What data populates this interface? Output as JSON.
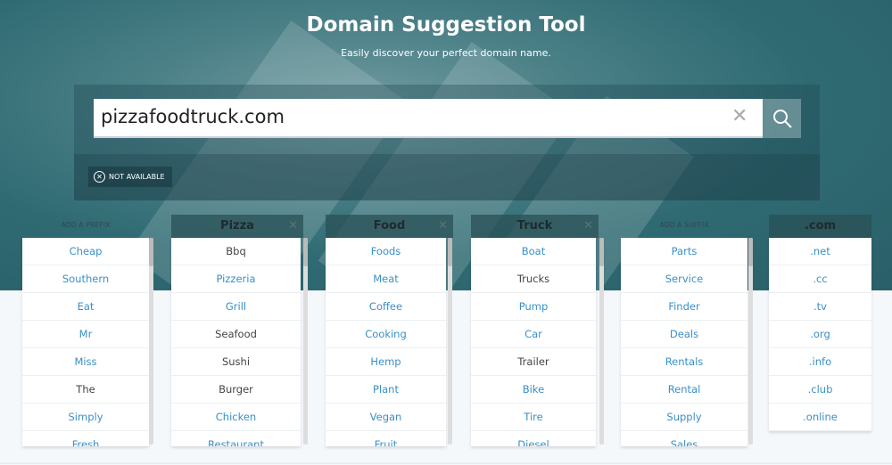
{
  "header": {
    "title": "Domain Suggestion Tool",
    "subtitle": "Easily discover your perfect domain name."
  },
  "search": {
    "value": "pizzafoodtruck.com",
    "clear_icon": "close-icon",
    "search_icon": "magnifier-icon"
  },
  "status": {
    "label": "NOT AVAILABLE",
    "icon": "x-circle-icon"
  },
  "colors": {
    "link": "#3a8fc8",
    "text": "#444444",
    "hero": "#2f6a72"
  },
  "columns": [
    {
      "type": "prefix",
      "label": "ADD A PREFIX",
      "items": [
        {
          "t": "Cheap"
        },
        {
          "t": "Southern"
        },
        {
          "t": "Eat"
        },
        {
          "t": "Mr"
        },
        {
          "t": "Miss"
        },
        {
          "t": "The",
          "gray": true
        },
        {
          "t": "Simply"
        },
        {
          "t": "Fresh"
        }
      ]
    },
    {
      "type": "word",
      "label": "Pizza",
      "items": [
        {
          "t": "Bbq",
          "gray": true
        },
        {
          "t": "Pizzeria"
        },
        {
          "t": "Grill"
        },
        {
          "t": "Seafood",
          "gray": true
        },
        {
          "t": "Sushi",
          "gray": true
        },
        {
          "t": "Burger",
          "gray": true
        },
        {
          "t": "Chicken"
        },
        {
          "t": "Restaurant"
        }
      ]
    },
    {
      "type": "word",
      "label": "Food",
      "items": [
        {
          "t": "Foods"
        },
        {
          "t": "Meat"
        },
        {
          "t": "Coffee"
        },
        {
          "t": "Cooking"
        },
        {
          "t": "Hemp"
        },
        {
          "t": "Plant"
        },
        {
          "t": "Vegan"
        },
        {
          "t": "Fruit"
        }
      ]
    },
    {
      "type": "word",
      "label": "Truck",
      "items": [
        {
          "t": "Boat"
        },
        {
          "t": "Trucks",
          "gray": true
        },
        {
          "t": "Pump"
        },
        {
          "t": "Car"
        },
        {
          "t": "Trailer",
          "gray": true
        },
        {
          "t": "Bike"
        },
        {
          "t": "Tire"
        },
        {
          "t": "Diesel"
        }
      ]
    },
    {
      "type": "suffix",
      "label": "ADD A SUFFIX",
      "items": [
        {
          "t": "Parts"
        },
        {
          "t": "Service"
        },
        {
          "t": "Finder"
        },
        {
          "t": "Deals"
        },
        {
          "t": "Rentals"
        },
        {
          "t": "Rental"
        },
        {
          "t": "Supply"
        },
        {
          "t": "Sales"
        }
      ]
    },
    {
      "type": "tld",
      "label": ".com",
      "items": [
        {
          "t": ".net"
        },
        {
          "t": ".cc"
        },
        {
          "t": ".tv"
        },
        {
          "t": ".org"
        },
        {
          "t": ".info"
        },
        {
          "t": ".club"
        },
        {
          "t": ".online"
        }
      ]
    }
  ]
}
